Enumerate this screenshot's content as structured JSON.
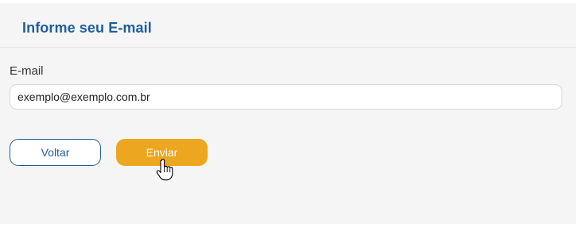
{
  "form": {
    "title": "Informe seu E-mail",
    "email_label": "E-mail",
    "email_value": "exemplo@exemplo.com.br"
  },
  "actions": {
    "back_label": "Voltar",
    "send_label": "Enviar"
  },
  "icons": {
    "cursor": "hand-pointer-icon"
  },
  "colors": {
    "title": "#1f5e9e",
    "primary": "#eda61f",
    "secondary_border": "#1f5e9e"
  }
}
